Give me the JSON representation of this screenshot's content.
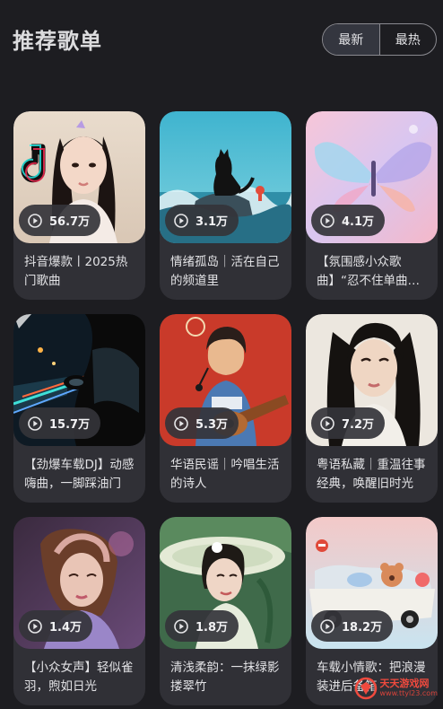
{
  "header": {
    "title": "推荐歌单",
    "sort_options": [
      "最新",
      "最热"
    ]
  },
  "playlists": [
    {
      "plays": "56.7万",
      "title": "抖音爆款丨2025热门歌曲",
      "cover": "tiktok-girl-portrait"
    },
    {
      "plays": "3.1万",
      "title": "情绪孤岛｜活在自己的频道里",
      "cover": "black-cat-on-rock-by-sea"
    },
    {
      "plays": "4.1万",
      "title": "【氛围感小众歌曲】“忍不住单曲循环",
      "cover": "pastel-butterfly"
    },
    {
      "plays": "15.7万",
      "title": "【劲爆车载DJ】动感嗨曲，一脚踩油门",
      "cover": "car-night-city-lights"
    },
    {
      "plays": "5.3万",
      "title": "华语民谣｜吟唱生活的诗人",
      "cover": "guitarist-illustration"
    },
    {
      "plays": "7.2万",
      "title": "粤语私藏｜重温往事经典，唤醒旧时光",
      "cover": "retro-woman-portrait"
    },
    {
      "plays": "1.4万",
      "title": "【小众女声】轻似雀羽，煦如日光",
      "cover": "girl-hands-on-head"
    },
    {
      "plays": "1.8万",
      "title": "清浅柔韵：一抹绿影搂翠竹",
      "cover": "woman-green-hat"
    },
    {
      "plays": "18.2万",
      "title": "车载小情歌：把浪漫装进后备箱",
      "cover": "convertible-car-teddy"
    }
  ],
  "watermark": {
    "name": "天天游戏网",
    "url": "www.ttyl23.com"
  },
  "colors": {
    "background": "#1d1d21",
    "card": "#303036",
    "badge": "#34343a",
    "text": "#e2e2e5"
  }
}
